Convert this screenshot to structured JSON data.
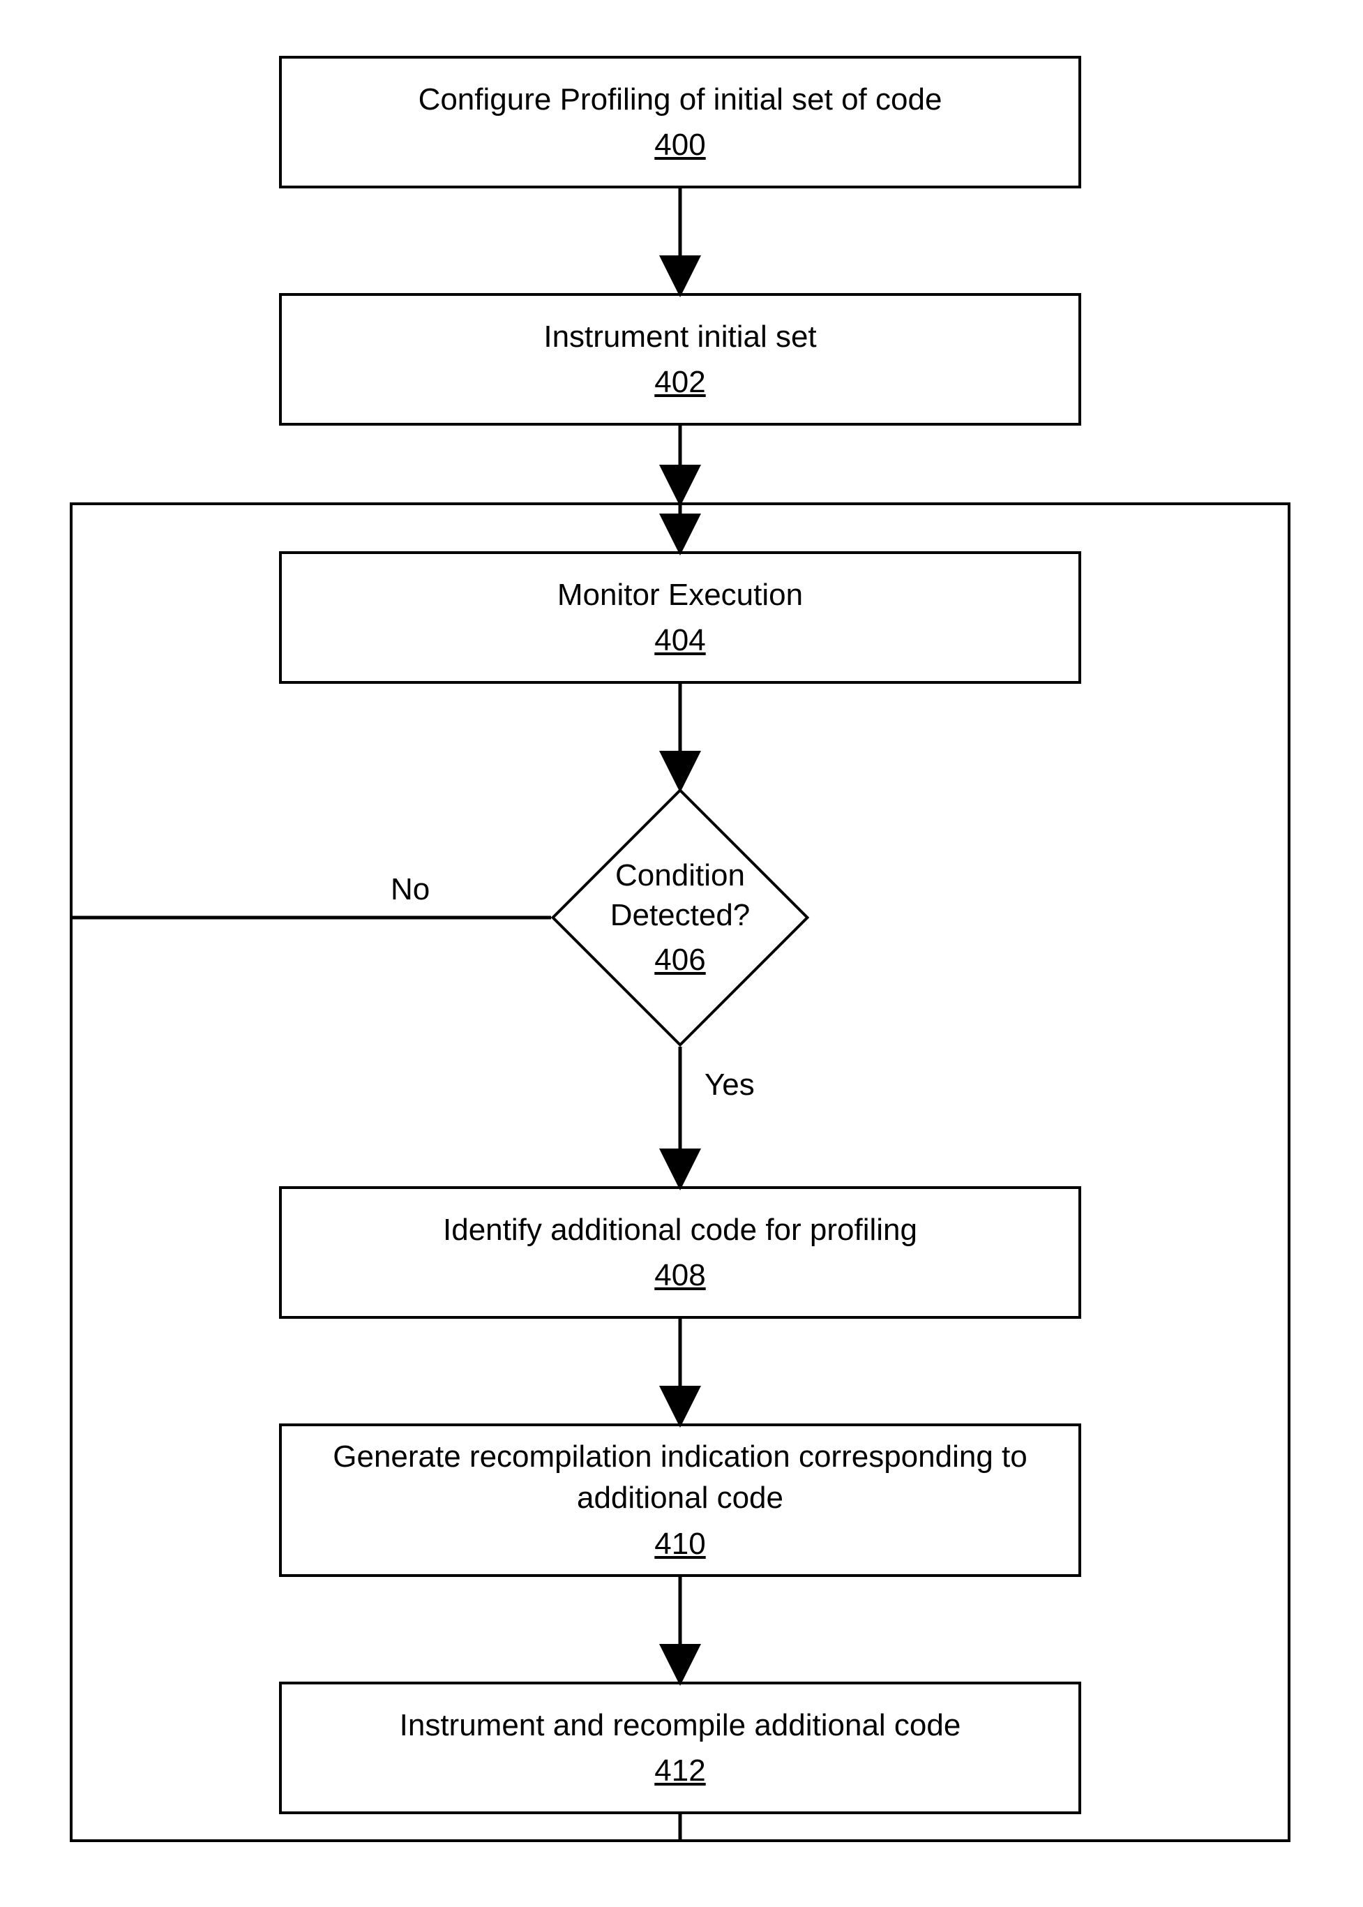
{
  "steps": {
    "s400": {
      "text": "Configure Profiling of initial set of code",
      "ref": "400"
    },
    "s402": {
      "text": "Instrument initial set",
      "ref": "402"
    },
    "s404": {
      "text": "Monitor Execution",
      "ref": "404"
    },
    "s406": {
      "text1": "Condition",
      "text2": "Detected?",
      "ref": "406"
    },
    "s408": {
      "text": "Identify additional code for profiling",
      "ref": "408"
    },
    "s410": {
      "text1": "Generate recompilation indication corresponding to",
      "text2": "additional code",
      "ref": "410"
    },
    "s412": {
      "text": "Instrument and recompile additional code",
      "ref": "412"
    }
  },
  "labels": {
    "no": "No",
    "yes": "Yes"
  }
}
